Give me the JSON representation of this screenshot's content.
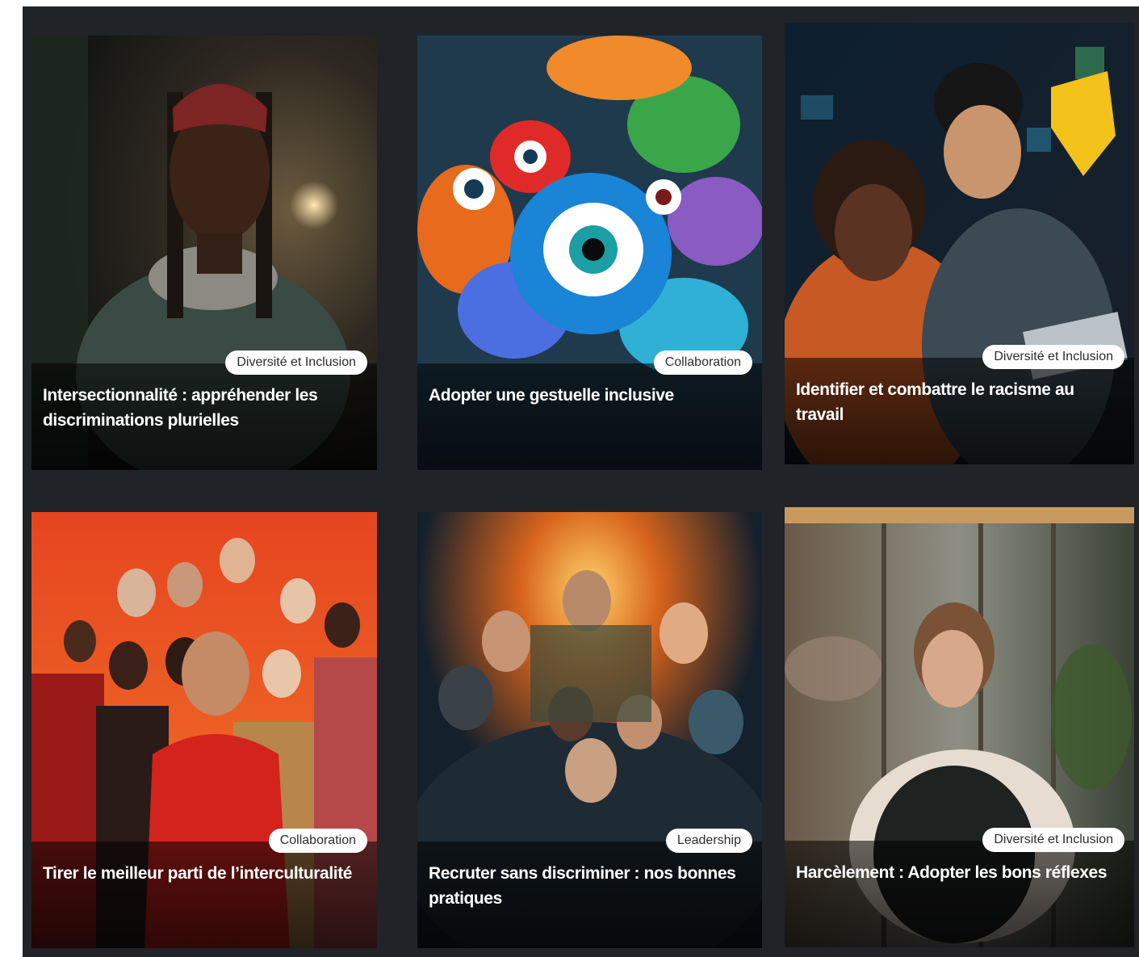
{
  "cards": [
    {
      "title": "Intersectionnalité : appréhender les discriminations plurielles",
      "tag": "Diversité et Inclusion"
    },
    {
      "title": "Adopter une gestuelle inclusive",
      "tag": "Collaboration"
    },
    {
      "title": "Identifier et combattre le racisme au travail",
      "tag": "Diversité et Inclusion"
    },
    {
      "title": "Tirer le meilleur parti de l’interculturalité",
      "tag": "Collaboration"
    },
    {
      "title": "Recruter sans discriminer : nos bonnes pratiques",
      "tag": "Leadership"
    },
    {
      "title": "Harcèlement : Adopter les bons réflexes",
      "tag": "Diversité et Inclusion"
    }
  ],
  "colors": {
    "background": "#202327",
    "badge_bg": "#ffffff",
    "badge_text": "#2c2c2c",
    "title_text": "#ffffff"
  }
}
